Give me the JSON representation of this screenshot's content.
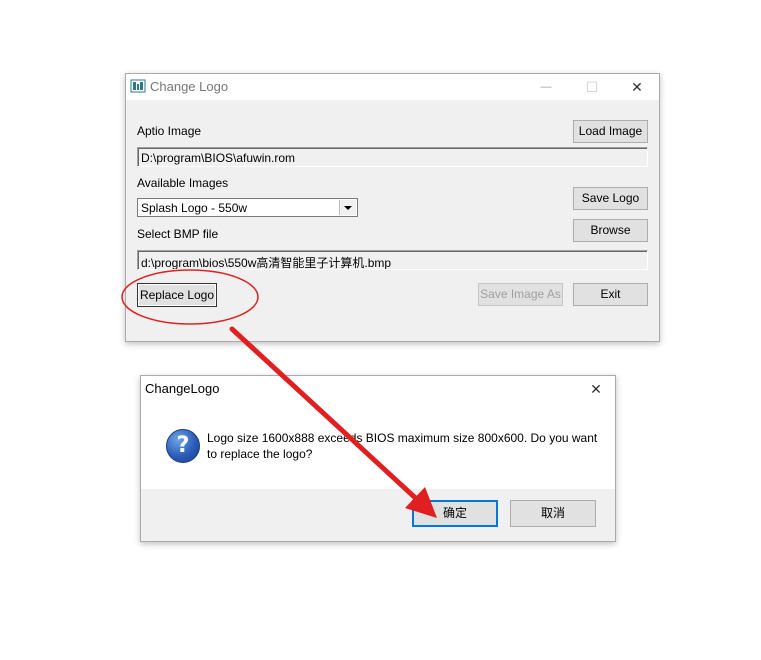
{
  "main_window": {
    "title": "Change Logo",
    "aptio_label": "Aptio Image",
    "aptio_path": "D:\\program\\BIOS\\afuwin.rom",
    "load_image": "Load Image",
    "available_label": "Available Images",
    "available_selected": "Splash Logo - 550w",
    "save_logo": "Save Logo",
    "select_bmp_label": "Select BMP file",
    "browse": "Browse",
    "bmp_path": "d:\\program\\bios\\550w高清智能里子计算机.bmp",
    "replace_logo": "Replace Logo",
    "save_image_as": "Save Image As",
    "exit": "Exit",
    "minimize_glyph": "—",
    "maximize_glyph": "☐",
    "close_glyph": "✕"
  },
  "dialog": {
    "title": "ChangeLogo",
    "message_line1": "Logo size 1600x888 exceeds BIOS maximum size 800x600. Do you want",
    "message_line2": "to replace the logo?",
    "ok": "确定",
    "cancel": "取消",
    "close_glyph": "✕",
    "icon_glyph": "?"
  },
  "annotation_colors": {
    "highlight": "#e02020"
  }
}
